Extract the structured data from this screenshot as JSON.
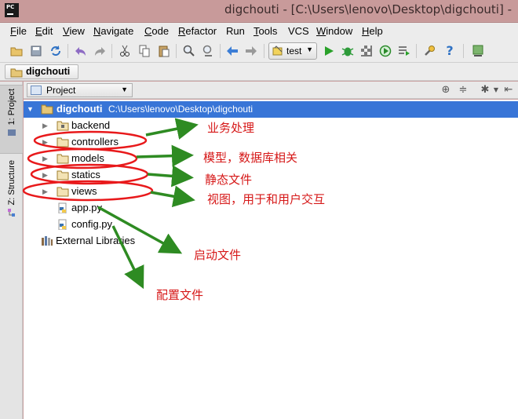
{
  "window": {
    "logo_text": "PC",
    "title": "digchouti - [C:\\Users\\lenovo\\Desktop\\digchouti] - "
  },
  "menu": {
    "items": [
      {
        "mnemonic": "F",
        "rest": "ile"
      },
      {
        "mnemonic": "E",
        "rest": "dit"
      },
      {
        "mnemonic": "V",
        "rest": "iew"
      },
      {
        "mnemonic": "N",
        "rest": "avigate"
      },
      {
        "mnemonic": "C",
        "rest": "ode"
      },
      {
        "mnemonic": "R",
        "rest": "efactor"
      },
      {
        "mnemonic": "",
        "rest": "Run"
      },
      {
        "mnemonic": "T",
        "rest": "ools"
      },
      {
        "mnemonic": "",
        "rest": "VCS"
      },
      {
        "mnemonic": "W",
        "rest": "indow"
      },
      {
        "mnemonic": "H",
        "rest": "elp"
      }
    ]
  },
  "toolbar": {
    "run_config": "test",
    "icons": [
      "open-folder-icon",
      "save-icon",
      "sync-icon",
      "undo-icon",
      "redo-icon",
      "cut-icon",
      "copy-icon",
      "paste-icon",
      "find-icon",
      "replace-icon",
      "back-icon",
      "forward-icon",
      "run-icon",
      "debug-icon",
      "coverage-icon",
      "profile-icon",
      "run-tests-icon",
      "settings-wrench-icon",
      "help-icon",
      "sdk-icon"
    ]
  },
  "navbar": {
    "breadcrumb": "digchouti"
  },
  "leftbar": {
    "project_tab": "1: Project",
    "structure_tab": "Z: Structure"
  },
  "panel": {
    "view_mode": "Project"
  },
  "tree": {
    "root": {
      "name": "digchouti",
      "path": "C:\\Users\\lenovo\\Desktop\\digchouti"
    },
    "folders": [
      "backend",
      "controllers",
      "models",
      "statics",
      "views"
    ],
    "files": [
      "app.py",
      "config.py"
    ],
    "external": "External Libraries"
  },
  "annotations": {
    "controllers": "业务处理",
    "models": "模型，数据库相关",
    "statics": "静态文件",
    "views": "视图，用于和用户交互",
    "app_py": "启动文件",
    "config_py": "配置文件"
  },
  "colors": {
    "selection": "#3875d7",
    "annotation_text": "#d61818",
    "ellipse": "#e8191b",
    "arrow": "#2e8b22",
    "titlebar": "#c89a9a"
  }
}
